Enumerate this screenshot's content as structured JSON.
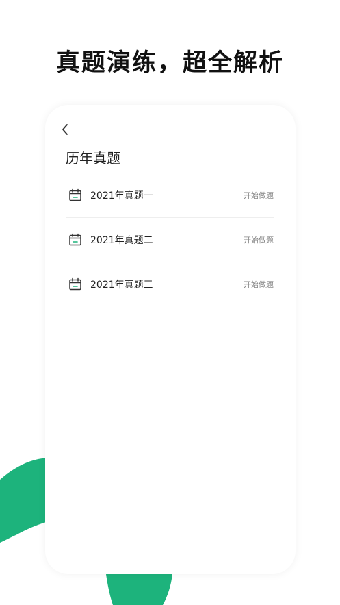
{
  "headline": "真题演练，超全解析",
  "card": {
    "title": "历年真题",
    "items": [
      {
        "label": "2021年真题一",
        "action": "开始做题"
      },
      {
        "label": "2021年真题二",
        "action": "开始做题"
      },
      {
        "label": "2021年真题三",
        "action": "开始做题"
      }
    ]
  },
  "colors": {
    "accent": "#1db37c",
    "text": "#222222",
    "muted": "#888888"
  }
}
